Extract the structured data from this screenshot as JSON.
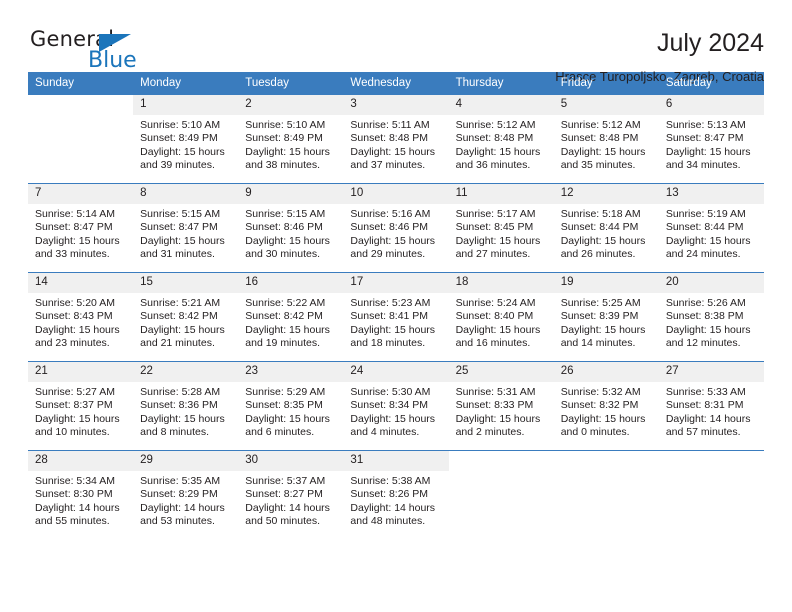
{
  "brand": {
    "name_dark": "General",
    "name_blue": "Blue",
    "accent_color": "#1b75bb"
  },
  "header": {
    "title": "July 2024",
    "subtitle": "Hrasce Turopoljsko, Zagreb, Croatia"
  },
  "calendar": {
    "header_bg": "#3a7cbe",
    "daynum_bg": "#f0f0f0",
    "weekday_headers": [
      "Sunday",
      "Monday",
      "Tuesday",
      "Wednesday",
      "Thursday",
      "Friday",
      "Saturday"
    ],
    "weeks": [
      [
        {
          "day": "",
          "sunrise": "",
          "sunset": "",
          "daylight_1": "",
          "daylight_2": ""
        },
        {
          "day": "1",
          "sunrise": "Sunrise: 5:10 AM",
          "sunset": "Sunset: 8:49 PM",
          "daylight_1": "Daylight: 15 hours",
          "daylight_2": "and 39 minutes."
        },
        {
          "day": "2",
          "sunrise": "Sunrise: 5:10 AM",
          "sunset": "Sunset: 8:49 PM",
          "daylight_1": "Daylight: 15 hours",
          "daylight_2": "and 38 minutes."
        },
        {
          "day": "3",
          "sunrise": "Sunrise: 5:11 AM",
          "sunset": "Sunset: 8:48 PM",
          "daylight_1": "Daylight: 15 hours",
          "daylight_2": "and 37 minutes."
        },
        {
          "day": "4",
          "sunrise": "Sunrise: 5:12 AM",
          "sunset": "Sunset: 8:48 PM",
          "daylight_1": "Daylight: 15 hours",
          "daylight_2": "and 36 minutes."
        },
        {
          "day": "5",
          "sunrise": "Sunrise: 5:12 AM",
          "sunset": "Sunset: 8:48 PM",
          "daylight_1": "Daylight: 15 hours",
          "daylight_2": "and 35 minutes."
        },
        {
          "day": "6",
          "sunrise": "Sunrise: 5:13 AM",
          "sunset": "Sunset: 8:47 PM",
          "daylight_1": "Daylight: 15 hours",
          "daylight_2": "and 34 minutes."
        }
      ],
      [
        {
          "day": "7",
          "sunrise": "Sunrise: 5:14 AM",
          "sunset": "Sunset: 8:47 PM",
          "daylight_1": "Daylight: 15 hours",
          "daylight_2": "and 33 minutes."
        },
        {
          "day": "8",
          "sunrise": "Sunrise: 5:15 AM",
          "sunset": "Sunset: 8:47 PM",
          "daylight_1": "Daylight: 15 hours",
          "daylight_2": "and 31 minutes."
        },
        {
          "day": "9",
          "sunrise": "Sunrise: 5:15 AM",
          "sunset": "Sunset: 8:46 PM",
          "daylight_1": "Daylight: 15 hours",
          "daylight_2": "and 30 minutes."
        },
        {
          "day": "10",
          "sunrise": "Sunrise: 5:16 AM",
          "sunset": "Sunset: 8:46 PM",
          "daylight_1": "Daylight: 15 hours",
          "daylight_2": "and 29 minutes."
        },
        {
          "day": "11",
          "sunrise": "Sunrise: 5:17 AM",
          "sunset": "Sunset: 8:45 PM",
          "daylight_1": "Daylight: 15 hours",
          "daylight_2": "and 27 minutes."
        },
        {
          "day": "12",
          "sunrise": "Sunrise: 5:18 AM",
          "sunset": "Sunset: 8:44 PM",
          "daylight_1": "Daylight: 15 hours",
          "daylight_2": "and 26 minutes."
        },
        {
          "day": "13",
          "sunrise": "Sunrise: 5:19 AM",
          "sunset": "Sunset: 8:44 PM",
          "daylight_1": "Daylight: 15 hours",
          "daylight_2": "and 24 minutes."
        }
      ],
      [
        {
          "day": "14",
          "sunrise": "Sunrise: 5:20 AM",
          "sunset": "Sunset: 8:43 PM",
          "daylight_1": "Daylight: 15 hours",
          "daylight_2": "and 23 minutes."
        },
        {
          "day": "15",
          "sunrise": "Sunrise: 5:21 AM",
          "sunset": "Sunset: 8:42 PM",
          "daylight_1": "Daylight: 15 hours",
          "daylight_2": "and 21 minutes."
        },
        {
          "day": "16",
          "sunrise": "Sunrise: 5:22 AM",
          "sunset": "Sunset: 8:42 PM",
          "daylight_1": "Daylight: 15 hours",
          "daylight_2": "and 19 minutes."
        },
        {
          "day": "17",
          "sunrise": "Sunrise: 5:23 AM",
          "sunset": "Sunset: 8:41 PM",
          "daylight_1": "Daylight: 15 hours",
          "daylight_2": "and 18 minutes."
        },
        {
          "day": "18",
          "sunrise": "Sunrise: 5:24 AM",
          "sunset": "Sunset: 8:40 PM",
          "daylight_1": "Daylight: 15 hours",
          "daylight_2": "and 16 minutes."
        },
        {
          "day": "19",
          "sunrise": "Sunrise: 5:25 AM",
          "sunset": "Sunset: 8:39 PM",
          "daylight_1": "Daylight: 15 hours",
          "daylight_2": "and 14 minutes."
        },
        {
          "day": "20",
          "sunrise": "Sunrise: 5:26 AM",
          "sunset": "Sunset: 8:38 PM",
          "daylight_1": "Daylight: 15 hours",
          "daylight_2": "and 12 minutes."
        }
      ],
      [
        {
          "day": "21",
          "sunrise": "Sunrise: 5:27 AM",
          "sunset": "Sunset: 8:37 PM",
          "daylight_1": "Daylight: 15 hours",
          "daylight_2": "and 10 minutes."
        },
        {
          "day": "22",
          "sunrise": "Sunrise: 5:28 AM",
          "sunset": "Sunset: 8:36 PM",
          "daylight_1": "Daylight: 15 hours",
          "daylight_2": "and 8 minutes."
        },
        {
          "day": "23",
          "sunrise": "Sunrise: 5:29 AM",
          "sunset": "Sunset: 8:35 PM",
          "daylight_1": "Daylight: 15 hours",
          "daylight_2": "and 6 minutes."
        },
        {
          "day": "24",
          "sunrise": "Sunrise: 5:30 AM",
          "sunset": "Sunset: 8:34 PM",
          "daylight_1": "Daylight: 15 hours",
          "daylight_2": "and 4 minutes."
        },
        {
          "day": "25",
          "sunrise": "Sunrise: 5:31 AM",
          "sunset": "Sunset: 8:33 PM",
          "daylight_1": "Daylight: 15 hours",
          "daylight_2": "and 2 minutes."
        },
        {
          "day": "26",
          "sunrise": "Sunrise: 5:32 AM",
          "sunset": "Sunset: 8:32 PM",
          "daylight_1": "Daylight: 15 hours",
          "daylight_2": "and 0 minutes."
        },
        {
          "day": "27",
          "sunrise": "Sunrise: 5:33 AM",
          "sunset": "Sunset: 8:31 PM",
          "daylight_1": "Daylight: 14 hours",
          "daylight_2": "and 57 minutes."
        }
      ],
      [
        {
          "day": "28",
          "sunrise": "Sunrise: 5:34 AM",
          "sunset": "Sunset: 8:30 PM",
          "daylight_1": "Daylight: 14 hours",
          "daylight_2": "and 55 minutes."
        },
        {
          "day": "29",
          "sunrise": "Sunrise: 5:35 AM",
          "sunset": "Sunset: 8:29 PM",
          "daylight_1": "Daylight: 14 hours",
          "daylight_2": "and 53 minutes."
        },
        {
          "day": "30",
          "sunrise": "Sunrise: 5:37 AM",
          "sunset": "Sunset: 8:27 PM",
          "daylight_1": "Daylight: 14 hours",
          "daylight_2": "and 50 minutes."
        },
        {
          "day": "31",
          "sunrise": "Sunrise: 5:38 AM",
          "sunset": "Sunset: 8:26 PM",
          "daylight_1": "Daylight: 14 hours",
          "daylight_2": "and 48 minutes."
        },
        {
          "day": "",
          "sunrise": "",
          "sunset": "",
          "daylight_1": "",
          "daylight_2": ""
        },
        {
          "day": "",
          "sunrise": "",
          "sunset": "",
          "daylight_1": "",
          "daylight_2": ""
        },
        {
          "day": "",
          "sunrise": "",
          "sunset": "",
          "daylight_1": "",
          "daylight_2": ""
        }
      ]
    ]
  }
}
